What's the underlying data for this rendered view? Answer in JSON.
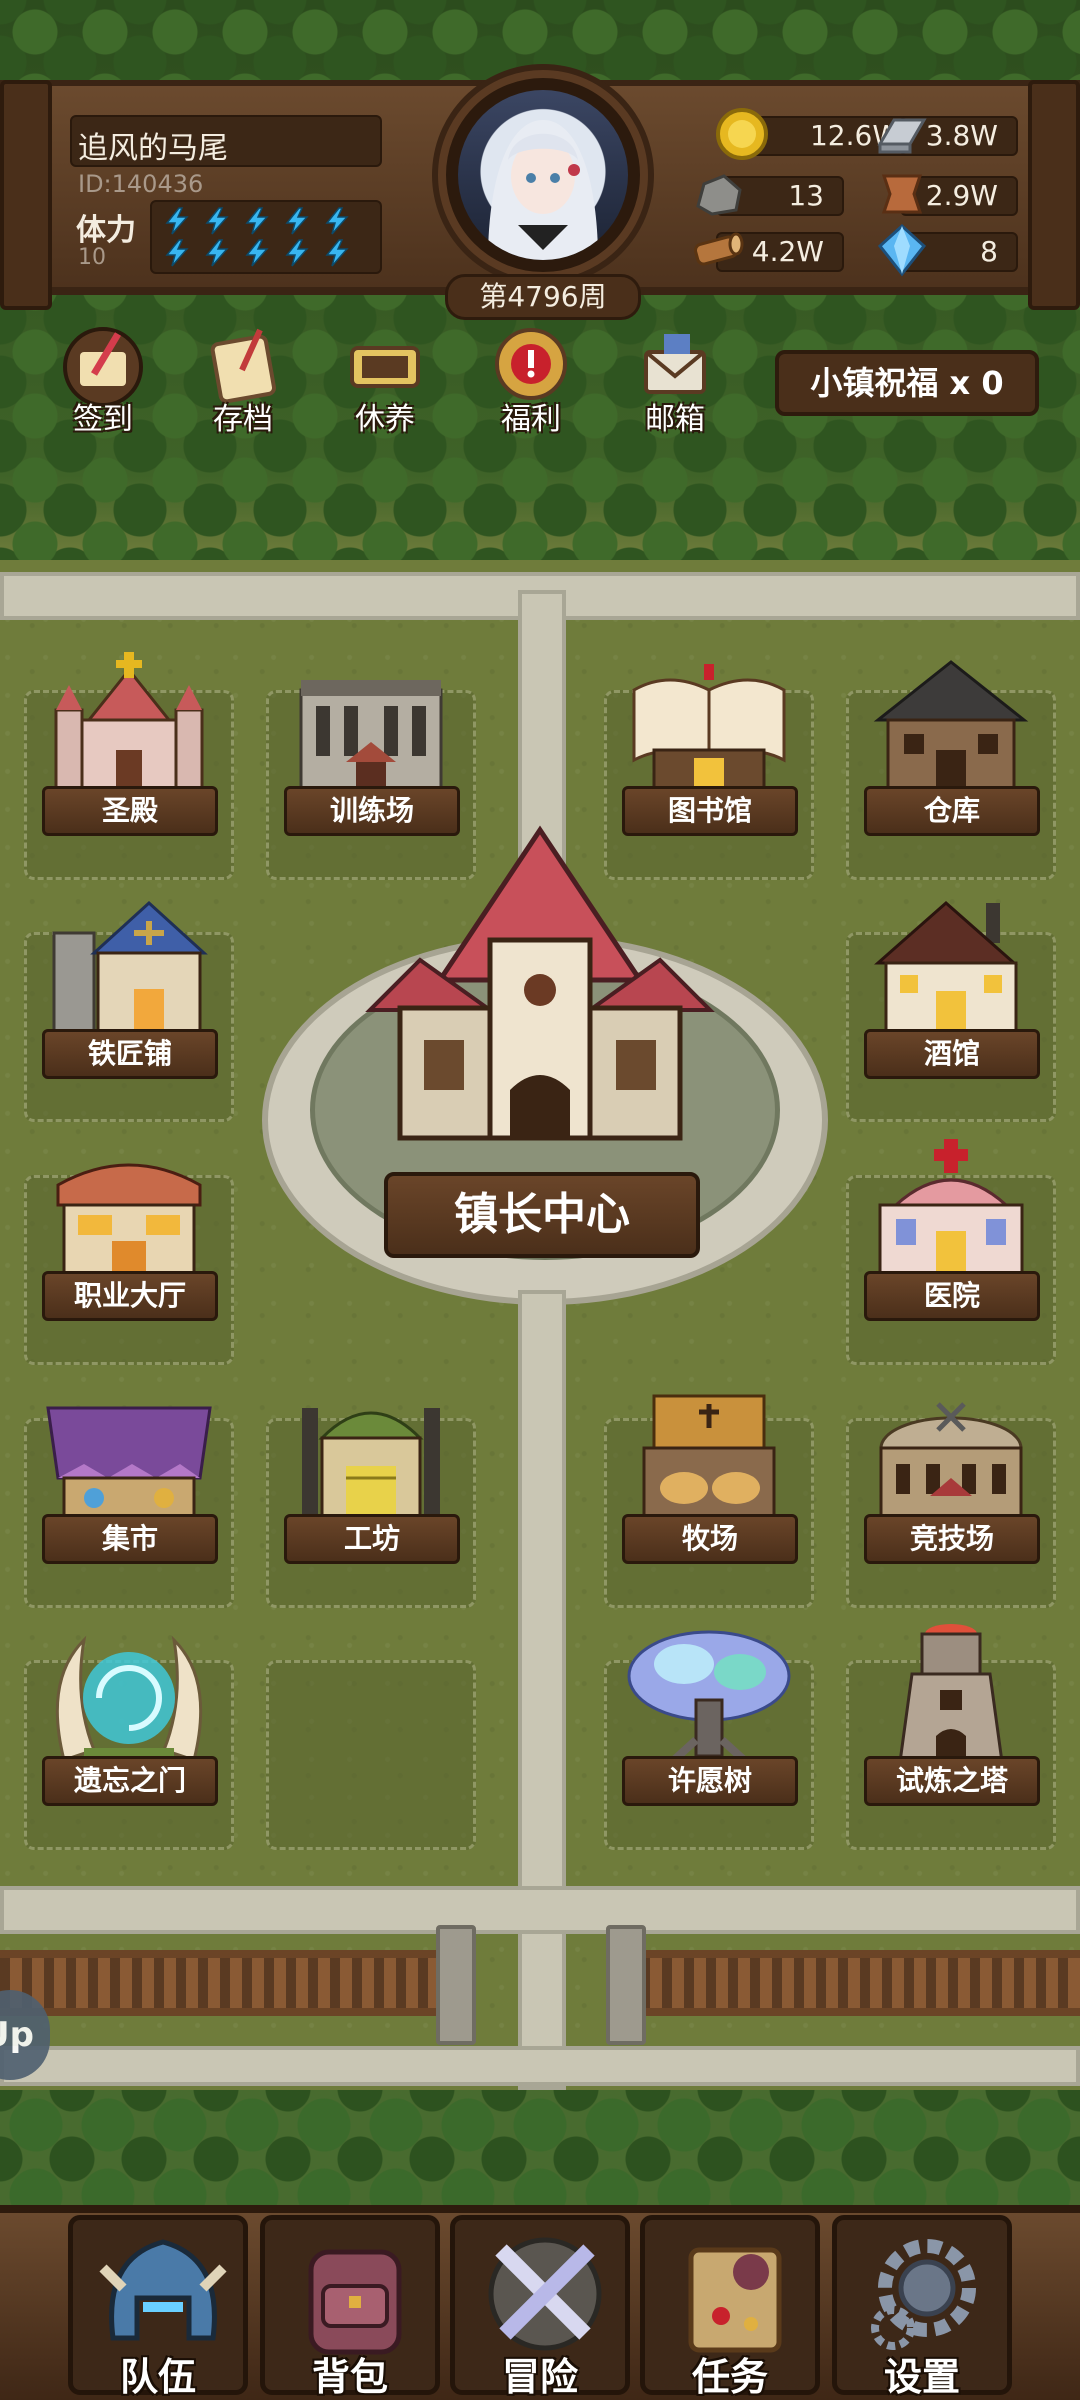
{
  "player": {
    "name": "追风的马尾",
    "id_text": "ID:140436",
    "stamina_label": "体力",
    "stamina_value": "10",
    "stamina_bolts": 10,
    "week": "第4796周"
  },
  "resources": {
    "gold": "12.6W",
    "iron": "3.8W",
    "stone": "13",
    "leather": "2.9W",
    "wood": "4.2W",
    "crystal": "8"
  },
  "actions": [
    {
      "label": "签到",
      "icon": "quill-scroll-icon"
    },
    {
      "label": "存档",
      "icon": "save-scroll-icon"
    },
    {
      "label": "休养",
      "icon": "rest-scroll-icon"
    },
    {
      "label": "福利",
      "icon": "gift-alert-icon"
    },
    {
      "label": "邮箱",
      "icon": "mail-icon"
    }
  ],
  "town_blessing": "小镇祝福 x 0",
  "buildings": {
    "holy_hall": "圣殿",
    "training_ground": "训练场",
    "library": "图书馆",
    "warehouse": "仓库",
    "blacksmith": "铁匠铺",
    "tavern": "酒馆",
    "job_hall": "职业大厅",
    "hospital": "医院",
    "market": "集市",
    "workshop": "工坊",
    "ranch": "牧场",
    "arena": "竞技场",
    "forgotten_gate": "遗忘之门",
    "wishing_tree": "许愿树",
    "trial_tower": "试炼之塔",
    "mayor_center": "镇长中心"
  },
  "side_tab": "Up",
  "nav": [
    {
      "label": "队伍",
      "icon": "helmet-icon"
    },
    {
      "label": "背包",
      "icon": "backpack-icon"
    },
    {
      "label": "冒险",
      "icon": "crossed-swords-icon"
    },
    {
      "label": "任务",
      "icon": "quest-scroll-icon"
    },
    {
      "label": "设置",
      "icon": "gear-icon"
    }
  ],
  "colors": {
    "grass": "#6f7c3b",
    "wood_dark": "#3c2716",
    "wood_mid": "#6b4a2e",
    "road": "#c9c6b4",
    "stamina_bolt": "#38b6f0"
  }
}
